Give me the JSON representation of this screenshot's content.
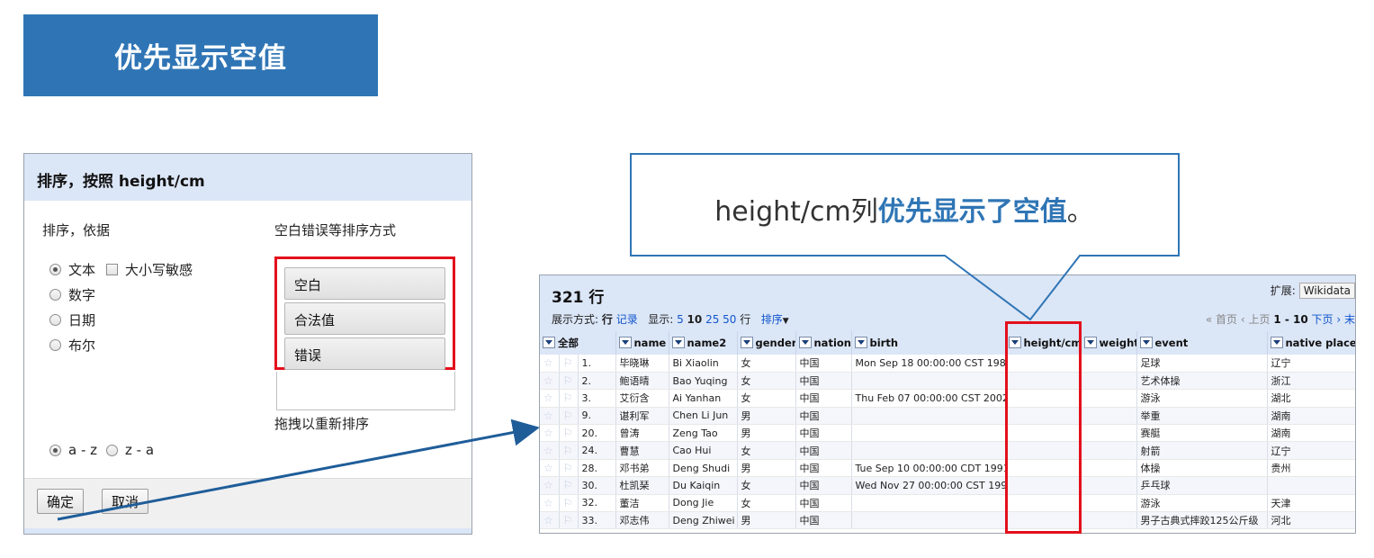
{
  "banner": {
    "title": "优先显示空值"
  },
  "dialog": {
    "title": "排序，按照 height/cm",
    "sort_by_label": "排序，依据",
    "order_label": "空白错误等排序方式",
    "options": [
      {
        "label": "文本",
        "selected": true
      },
      {
        "label": "数字",
        "selected": false
      },
      {
        "label": "日期",
        "selected": false
      },
      {
        "label": "布尔",
        "selected": false
      }
    ],
    "case_sensitive_label": "大小写敏感",
    "order_items": [
      "空白",
      "合法值",
      "错误"
    ],
    "drag_hint": "拖拽以重新排序",
    "direction": [
      {
        "label": "a - z",
        "selected": true
      },
      {
        "label": "z - a",
        "selected": false
      }
    ],
    "ok_label": "确定",
    "cancel_label": "取消"
  },
  "callout": {
    "prefix": "height/cm列",
    "emphasis": "优先显示了空值",
    "suffix": "。"
  },
  "panel": {
    "row_count": "321 行",
    "extend_label": "扩展:",
    "extend_button": "Wikidata",
    "view_label": "展示方式:",
    "view_rows": "行",
    "view_records": "记录",
    "show_label": "显示:",
    "show_5": "5",
    "show_10": "10",
    "show_25": "25",
    "show_50": "50",
    "show_suffix": "行",
    "sort_menu": "排序",
    "pager_first": "« 首页",
    "pager_prev": "‹ 上页",
    "pager_range": "1 - 10",
    "pager_next": "下页 ›",
    "pager_last": "末"
  },
  "table": {
    "all_label": "全部",
    "columns": [
      "name",
      "name2",
      "gender",
      "nation",
      "birth",
      "height/cm",
      "weight",
      "event",
      "native place"
    ],
    "rows": [
      {
        "n": "1.",
        "name": "毕晓琳",
        "name2": "Bi Xiaolin",
        "gender": "女",
        "nation": "中国",
        "birth": "Mon Sep 18 00:00:00 CST 1989",
        "height": "",
        "weight": "",
        "event": "足球",
        "place": "辽宁"
      },
      {
        "n": "2.",
        "name": "鲍语晴",
        "name2": "Bao Yuqing",
        "gender": "女",
        "nation": "中国",
        "birth": "",
        "height": "",
        "weight": "",
        "event": "艺术体操",
        "place": "浙江"
      },
      {
        "n": "3.",
        "name": "艾衍含",
        "name2": "Ai Yanhan",
        "gender": "女",
        "nation": "中国",
        "birth": "Thu Feb 07 00:00:00 CST 2002",
        "height": "",
        "weight": "",
        "event": "游泳",
        "place": "湖北"
      },
      {
        "n": "9.",
        "name": "谌利军",
        "name2": "Chen Li Jun",
        "gender": "男",
        "nation": "中国",
        "birth": "",
        "height": "",
        "weight": "",
        "event": "举重",
        "place": "湖南"
      },
      {
        "n": "20.",
        "name": "曾涛",
        "name2": "Zeng Tao",
        "gender": "男",
        "nation": "中国",
        "birth": "",
        "height": "",
        "weight": "",
        "event": "赛艇",
        "place": "湖南"
      },
      {
        "n": "24.",
        "name": "曹慧",
        "name2": "Cao Hui",
        "gender": "女",
        "nation": "中国",
        "birth": "",
        "height": "",
        "weight": "",
        "event": "射箭",
        "place": "辽宁"
      },
      {
        "n": "28.",
        "name": "邓书弟",
        "name2": "Deng Shudi",
        "gender": "男",
        "nation": "中国",
        "birth": "Tue Sep 10 00:00:00 CDT 1991",
        "height": "",
        "weight": "",
        "event": "体操",
        "place": "贵州"
      },
      {
        "n": "30.",
        "name": "杜凯琹",
        "name2": "Du Kaiqin",
        "gender": "女",
        "nation": "中国",
        "birth": "Wed Nov 27 00:00:00 CST 1996",
        "height": "",
        "weight": "",
        "event": "乒乓球",
        "place": ""
      },
      {
        "n": "32.",
        "name": "董洁",
        "name2": "Dong Jie",
        "gender": "女",
        "nation": "中国",
        "birth": "",
        "height": "",
        "weight": "",
        "event": "游泳",
        "place": "天津"
      },
      {
        "n": "33.",
        "name": "邓志伟",
        "name2": "Deng Zhiwei",
        "gender": "男",
        "nation": "中国",
        "birth": "",
        "height": "",
        "weight": "",
        "event": "男子古典式摔跤125公斤级",
        "place": "河北"
      }
    ]
  },
  "colors": {
    "accent_blue": "#2f75b5",
    "highlight_red": "#e3101c",
    "header_bg": "#dbe6f7"
  }
}
